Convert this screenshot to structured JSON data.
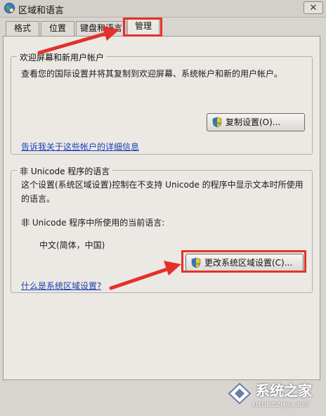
{
  "window": {
    "title": "区域和语言",
    "close_glyph": "✕"
  },
  "tabs": [
    {
      "label": "格式"
    },
    {
      "label": "位置"
    },
    {
      "label": "键盘和语言"
    },
    {
      "label": "管理"
    }
  ],
  "welcome_group": {
    "legend": "欢迎屏幕和新用户帐户",
    "description": "查看您的国际设置并将其复制到欢迎屏幕、系统帐户和新的用户帐户。",
    "copy_button": "复制设置(O)...",
    "info_link": "告诉我关于这些帐户的详细信息"
  },
  "unicode_group": {
    "legend": "非 Unicode 程序的语言",
    "description_line1": "这个设置(系统区域设置)控制在不支持 Unicode 的程序中显示文本时所使用",
    "description_line2": "的语言。",
    "current_label": "非 Unicode 程序中所使用的当前语言:",
    "current_value": "中文(简体，中国)",
    "change_button": "更改系统区域设置(C)...",
    "help_link": "什么是系统区域设置?"
  },
  "watermark": {
    "brand": "系统之家",
    "url": "XITONGZHIJIA.NET"
  },
  "icons": {
    "title": "globe-icon",
    "shield": "uac-shield-icon"
  },
  "colors": {
    "annotation": "#e2322a",
    "link": "#1a3fb5"
  }
}
